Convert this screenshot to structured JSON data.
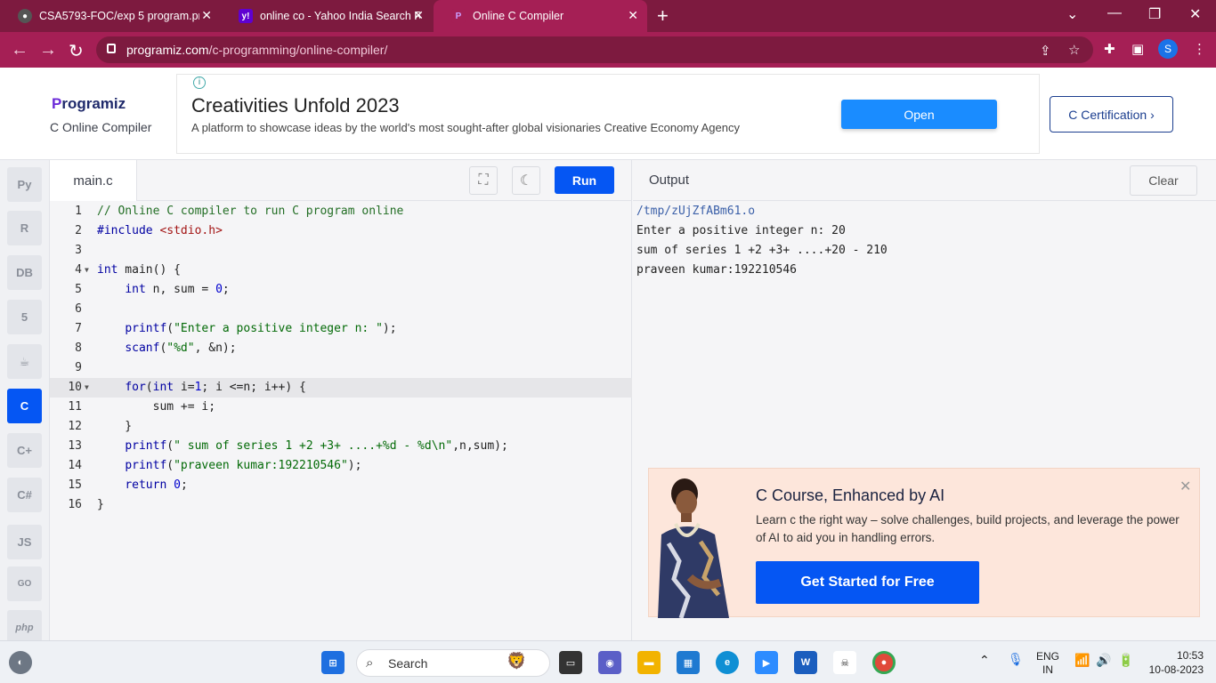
{
  "browser": {
    "tabs": [
      {
        "title": "CSA5793-FOC/exp 5 program.pn",
        "icon": "github-icon"
      },
      {
        "title": "online co - Yahoo India Search Re",
        "icon": "yahoo-icon"
      },
      {
        "title": "Online C Compiler",
        "icon": "programiz-icon"
      }
    ],
    "url_host": "programiz.com",
    "url_path": "/c-programming/online-compiler/",
    "profile_initial": "S"
  },
  "header": {
    "logo_text": "rogramiz",
    "logo_initial": "P",
    "subtitle": "C Online Compiler",
    "ad_title": "Creativities Unfold 2023",
    "ad_desc": "A platform to showcase ideas by the world's most sought-after global visionaries Creative Economy Agency",
    "ad_button": "Open",
    "cert_button": "C Certification ›"
  },
  "sidebar": {
    "languages": [
      "Python",
      "R",
      "SQL",
      "HTML",
      "Java",
      "C",
      "C++",
      "C#",
      "JS",
      "GO",
      "php"
    ]
  },
  "editor": {
    "filename": "main.c",
    "run_label": "Run"
  },
  "output": {
    "title": "Output",
    "clear_label": "Clear",
    "lines": [
      "/tmp/zUjZfABm61.o",
      "Enter a positive integer n: 20",
      "sum of series 1 +2 +3+ ....+20 - 210",
      "praveen kumar:192210546"
    ]
  },
  "promo": {
    "title": "C Course, Enhanced by AI",
    "desc": "Learn c the right way – solve challenges, build projects, and leverage the power of AI to aid you in handling errors.",
    "button": "Get Started for Free"
  },
  "taskbar": {
    "search_label": "Search",
    "lang_top": "ENG",
    "lang_bottom": "IN",
    "time": "10:53",
    "date": "10-08-2023"
  },
  "colors": {
    "browser_frame": "#a51f55",
    "accent": "#0556f3",
    "promo_bg": "#fde6db"
  }
}
